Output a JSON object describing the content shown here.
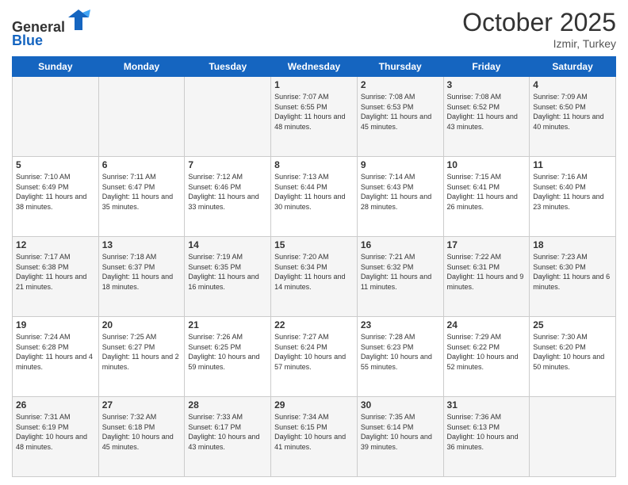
{
  "header": {
    "logo_line1": "General",
    "logo_line2": "Blue",
    "month": "October 2025",
    "location": "Izmir, Turkey"
  },
  "weekdays": [
    "Sunday",
    "Monday",
    "Tuesday",
    "Wednesday",
    "Thursday",
    "Friday",
    "Saturday"
  ],
  "weeks": [
    [
      {
        "day": "",
        "info": ""
      },
      {
        "day": "",
        "info": ""
      },
      {
        "day": "",
        "info": ""
      },
      {
        "day": "1",
        "info": "Sunrise: 7:07 AM\nSunset: 6:55 PM\nDaylight: 11 hours\nand 48 minutes."
      },
      {
        "day": "2",
        "info": "Sunrise: 7:08 AM\nSunset: 6:53 PM\nDaylight: 11 hours\nand 45 minutes."
      },
      {
        "day": "3",
        "info": "Sunrise: 7:08 AM\nSunset: 6:52 PM\nDaylight: 11 hours\nand 43 minutes."
      },
      {
        "day": "4",
        "info": "Sunrise: 7:09 AM\nSunset: 6:50 PM\nDaylight: 11 hours\nand 40 minutes."
      }
    ],
    [
      {
        "day": "5",
        "info": "Sunrise: 7:10 AM\nSunset: 6:49 PM\nDaylight: 11 hours\nand 38 minutes."
      },
      {
        "day": "6",
        "info": "Sunrise: 7:11 AM\nSunset: 6:47 PM\nDaylight: 11 hours\nand 35 minutes."
      },
      {
        "day": "7",
        "info": "Sunrise: 7:12 AM\nSunset: 6:46 PM\nDaylight: 11 hours\nand 33 minutes."
      },
      {
        "day": "8",
        "info": "Sunrise: 7:13 AM\nSunset: 6:44 PM\nDaylight: 11 hours\nand 30 minutes."
      },
      {
        "day": "9",
        "info": "Sunrise: 7:14 AM\nSunset: 6:43 PM\nDaylight: 11 hours\nand 28 minutes."
      },
      {
        "day": "10",
        "info": "Sunrise: 7:15 AM\nSunset: 6:41 PM\nDaylight: 11 hours\nand 26 minutes."
      },
      {
        "day": "11",
        "info": "Sunrise: 7:16 AM\nSunset: 6:40 PM\nDaylight: 11 hours\nand 23 minutes."
      }
    ],
    [
      {
        "day": "12",
        "info": "Sunrise: 7:17 AM\nSunset: 6:38 PM\nDaylight: 11 hours\nand 21 minutes."
      },
      {
        "day": "13",
        "info": "Sunrise: 7:18 AM\nSunset: 6:37 PM\nDaylight: 11 hours\nand 18 minutes."
      },
      {
        "day": "14",
        "info": "Sunrise: 7:19 AM\nSunset: 6:35 PM\nDaylight: 11 hours\nand 16 minutes."
      },
      {
        "day": "15",
        "info": "Sunrise: 7:20 AM\nSunset: 6:34 PM\nDaylight: 11 hours\nand 14 minutes."
      },
      {
        "day": "16",
        "info": "Sunrise: 7:21 AM\nSunset: 6:32 PM\nDaylight: 11 hours\nand 11 minutes."
      },
      {
        "day": "17",
        "info": "Sunrise: 7:22 AM\nSunset: 6:31 PM\nDaylight: 11 hours\nand 9 minutes."
      },
      {
        "day": "18",
        "info": "Sunrise: 7:23 AM\nSunset: 6:30 PM\nDaylight: 11 hours\nand 6 minutes."
      }
    ],
    [
      {
        "day": "19",
        "info": "Sunrise: 7:24 AM\nSunset: 6:28 PM\nDaylight: 11 hours\nand 4 minutes."
      },
      {
        "day": "20",
        "info": "Sunrise: 7:25 AM\nSunset: 6:27 PM\nDaylight: 11 hours\nand 2 minutes."
      },
      {
        "day": "21",
        "info": "Sunrise: 7:26 AM\nSunset: 6:25 PM\nDaylight: 10 hours\nand 59 minutes."
      },
      {
        "day": "22",
        "info": "Sunrise: 7:27 AM\nSunset: 6:24 PM\nDaylight: 10 hours\nand 57 minutes."
      },
      {
        "day": "23",
        "info": "Sunrise: 7:28 AM\nSunset: 6:23 PM\nDaylight: 10 hours\nand 55 minutes."
      },
      {
        "day": "24",
        "info": "Sunrise: 7:29 AM\nSunset: 6:22 PM\nDaylight: 10 hours\nand 52 minutes."
      },
      {
        "day": "25",
        "info": "Sunrise: 7:30 AM\nSunset: 6:20 PM\nDaylight: 10 hours\nand 50 minutes."
      }
    ],
    [
      {
        "day": "26",
        "info": "Sunrise: 7:31 AM\nSunset: 6:19 PM\nDaylight: 10 hours\nand 48 minutes."
      },
      {
        "day": "27",
        "info": "Sunrise: 7:32 AM\nSunset: 6:18 PM\nDaylight: 10 hours\nand 45 minutes."
      },
      {
        "day": "28",
        "info": "Sunrise: 7:33 AM\nSunset: 6:17 PM\nDaylight: 10 hours\nand 43 minutes."
      },
      {
        "day": "29",
        "info": "Sunrise: 7:34 AM\nSunset: 6:15 PM\nDaylight: 10 hours\nand 41 minutes."
      },
      {
        "day": "30",
        "info": "Sunrise: 7:35 AM\nSunset: 6:14 PM\nDaylight: 10 hours\nand 39 minutes."
      },
      {
        "day": "31",
        "info": "Sunrise: 7:36 AM\nSunset: 6:13 PM\nDaylight: 10 hours\nand 36 minutes."
      },
      {
        "day": "",
        "info": ""
      }
    ]
  ]
}
